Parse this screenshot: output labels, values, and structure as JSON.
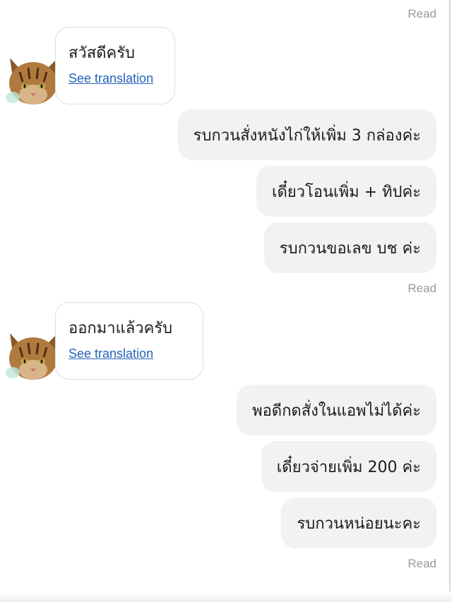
{
  "status": {
    "read_label": "Read"
  },
  "messages": {
    "m1": {
      "text": "สวัสดีครับ",
      "translate": "See translation"
    },
    "m2": {
      "text": "รบกวนสั่งหนังไก่ให้เพิ่ม 3 กล่องค่ะ"
    },
    "m3": {
      "text": "เดี๋ยวโอนเพิ่ม + ทิปค่ะ"
    },
    "m4": {
      "text": "รบกวนขอเลข บช ค่ะ"
    },
    "m5": {
      "text": "ออกมาแล้วครับ",
      "translate": "See translation"
    },
    "m6": {
      "text": "พอดีกดสั่งในแอพไม่ได้ค่ะ"
    },
    "m7": {
      "text": "เดี๋ยวจ่ายเพิ่ม 200 ค่ะ"
    },
    "m8": {
      "text": "รบกวนหน่อยนะคะ"
    }
  },
  "colors": {
    "outgoing_bubble": "#f2f2f3",
    "link": "#2563b8",
    "read_text": "#9a9a9a"
  },
  "icons": {
    "avatar": "cat-avatar-icon"
  }
}
